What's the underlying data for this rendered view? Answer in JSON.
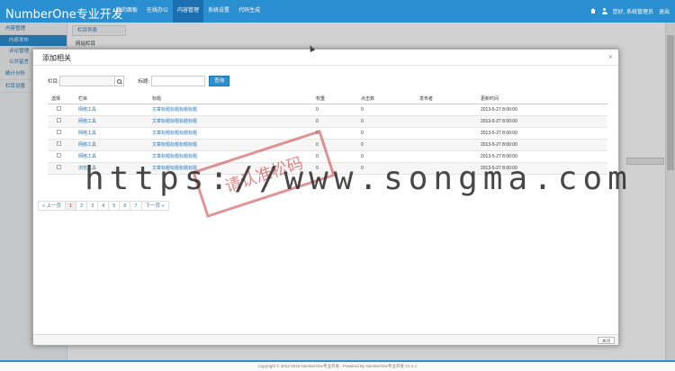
{
  "brand": "NumberOne专业开发",
  "nav": [
    "我的面板",
    "在线办公",
    "内容管理",
    "系统设置",
    "代码生成"
  ],
  "nav_active": 2,
  "top_right": {
    "user_label": "您好, 系统管理员",
    "logout": "退出"
  },
  "sidebar": {
    "groups": [
      "内容管理",
      "统计分析",
      "栏目设置"
    ],
    "items": [
      "内容发布",
      "评论管理",
      "公共留言"
    ]
  },
  "content": {
    "column_header": "栏目列表",
    "column_item": "网站栏目"
  },
  "modal": {
    "title": "添加相关",
    "close": "×",
    "search": {
      "column_label": "栏目:",
      "title_label": "标题:",
      "query_button": "查询"
    },
    "columns": [
      "选择",
      "栏目",
      "标题",
      "权重",
      "点击数",
      "发布者",
      "更新时间"
    ],
    "rows": [
      {
        "column": "网络工具",
        "title": "文章标题标题标题标题",
        "weight": "0",
        "hits": "0",
        "publisher": "",
        "updated": "2013-5-27 8:00:00"
      },
      {
        "column": "网络工具",
        "title": "文章标题标题标题标题",
        "weight": "0",
        "hits": "0",
        "publisher": "",
        "updated": "2013-5-27 8:00:00"
      },
      {
        "column": "网络工具",
        "title": "文章标题标题标题标题",
        "weight": "0",
        "hits": "0",
        "publisher": "",
        "updated": "2013-5-27 8:00:00"
      },
      {
        "column": "网络工具",
        "title": "文章标题标题标题标题",
        "weight": "0",
        "hits": "0",
        "publisher": "",
        "updated": "2013-5-27 8:00:00"
      },
      {
        "column": "网络工具",
        "title": "文章标题标题标题标题",
        "weight": "0",
        "hits": "0",
        "publisher": "",
        "updated": "2013-5-27 8:00:00"
      },
      {
        "column": "浏览工具",
        "title": "文章标题标题标题标题",
        "weight": "0",
        "hits": "0",
        "publisher": "",
        "updated": "2013-5-27 8:00:00"
      }
    ],
    "pager": {
      "prev": "« 上一页",
      "pages": [
        "1",
        "2",
        "3",
        "4",
        "5",
        "6",
        "7"
      ],
      "current": "1",
      "next": "下一页 »"
    },
    "close_button": "关闭"
  },
  "footer": "Copyright © 2012-2016 NumberOne专业开发 - Powered By NumberOne专业开发 V1.2.1",
  "watermark_url": "https://www.songma.com",
  "stamp_text": "请认准松码",
  "colors": {
    "primary": "#2a8fd0",
    "link": "#2a74b0",
    "stamp": "#c83c3c"
  }
}
